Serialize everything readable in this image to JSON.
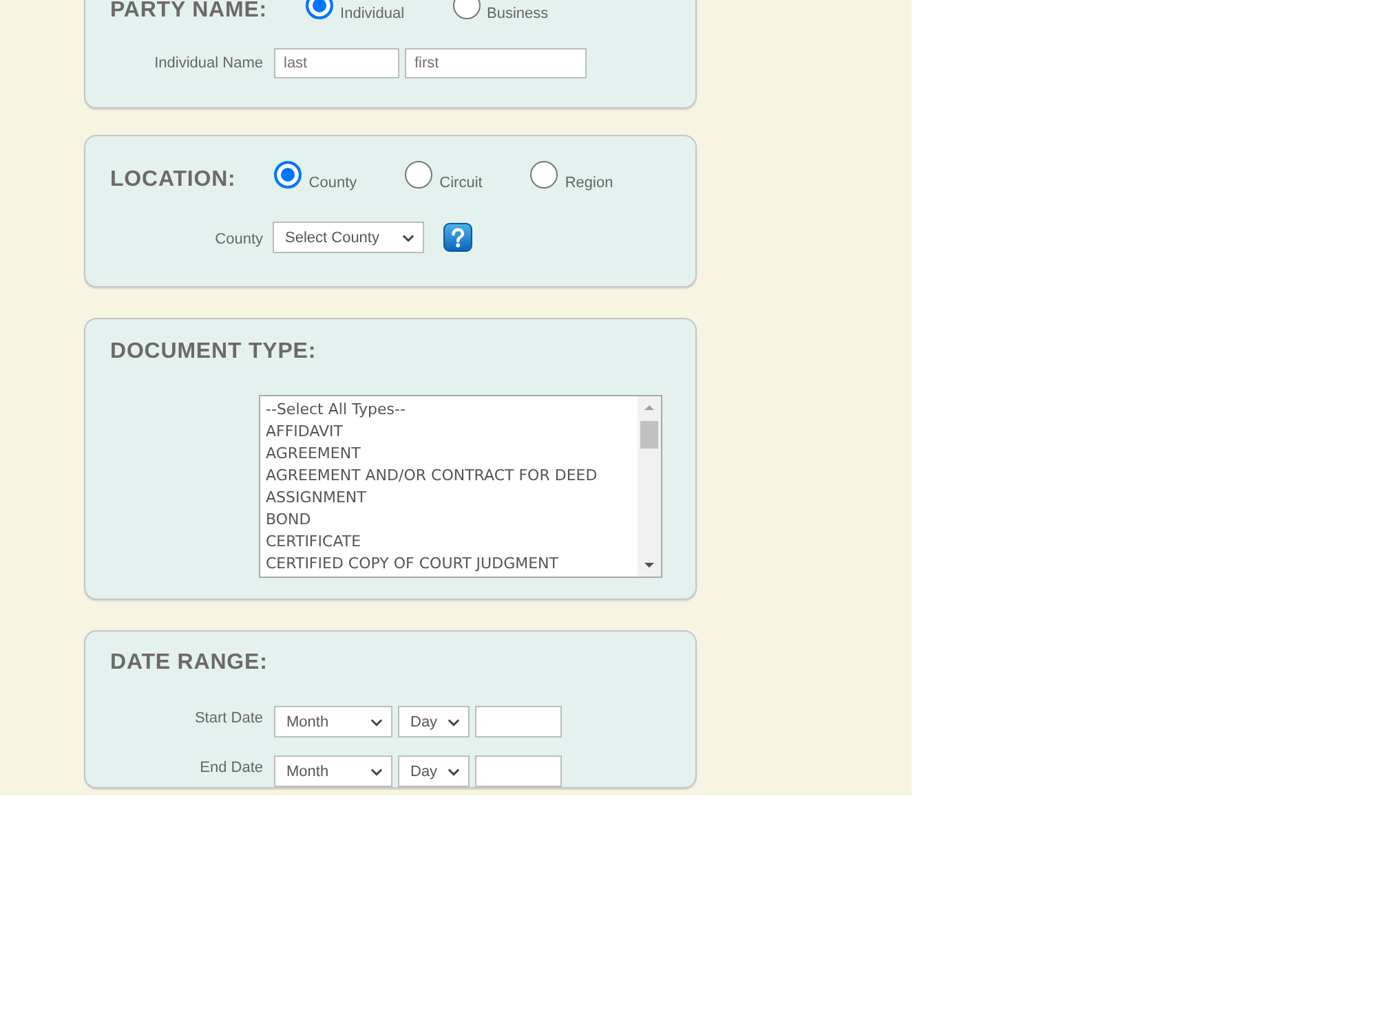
{
  "party_name": {
    "heading": "PARTY NAME:",
    "options": [
      {
        "label": "Individual",
        "selected": true
      },
      {
        "label": "Business",
        "selected": false
      }
    ],
    "name_label": "Individual Name",
    "name_fields": [
      {
        "placeholder": "last"
      },
      {
        "placeholder": "first"
      }
    ]
  },
  "location": {
    "heading": "LOCATION:",
    "options": [
      {
        "label": "County",
        "selected": true
      },
      {
        "label": "Circuit",
        "selected": false
      },
      {
        "label": "Region",
        "selected": false
      }
    ],
    "county_label": "County",
    "county_select": "Select County"
  },
  "document_type": {
    "heading": "DOCUMENT TYPE:",
    "options": [
      {
        "label": "--Select All Types--",
        "selected": false
      },
      {
        "label": "AFFIDAVIT",
        "selected": false
      },
      {
        "label": "AGREEMENT",
        "selected": false
      },
      {
        "label": "AGREEMENT AND/OR CONTRACT FOR DEED",
        "selected": false
      },
      {
        "label": "ASSIGNMENT",
        "selected": false
      },
      {
        "label": "BOND",
        "selected": false
      },
      {
        "label": "CERTIFICATE",
        "selected": false
      },
      {
        "label": "CERTIFIED COPY OF COURT JUDGMENT",
        "selected": false
      }
    ]
  },
  "date_range": {
    "heading": "DATE RANGE:",
    "rows": [
      {
        "label": "Start Date",
        "month": "Month",
        "day": "Day"
      },
      {
        "label": "End Date",
        "month": "Month",
        "day": "Day"
      }
    ]
  }
}
